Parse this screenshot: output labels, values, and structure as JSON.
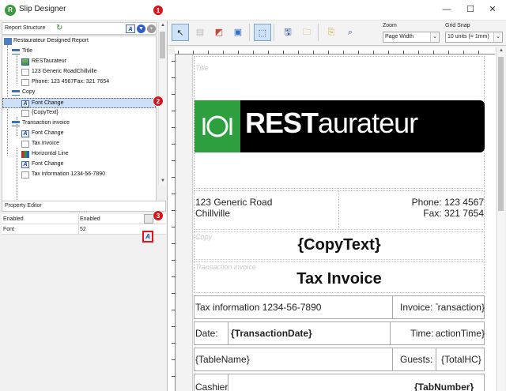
{
  "window": {
    "title": "Slip Designer",
    "minimize": "—",
    "maximize": "☐",
    "close": "✕"
  },
  "callouts": [
    "1",
    "2",
    "3"
  ],
  "report_structure": {
    "label": "Report Structure",
    "tree": [
      {
        "label": "Restaurateur Designed Report",
        "icon": "report-icon",
        "depth": 0
      },
      {
        "label": "Title",
        "icon": "section-icon",
        "depth": 1
      },
      {
        "label": "RESTaurateur",
        "icon": "image-icon",
        "depth": 2
      },
      {
        "label": "123 Generic RoadChillville",
        "icon": "text-icon",
        "depth": 2
      },
      {
        "label": "Phone: 123 4567Fax: 321 7654",
        "icon": "text-icon",
        "depth": 2
      },
      {
        "label": "Copy",
        "icon": "section-icon",
        "depth": 1
      },
      {
        "label": "Font Change",
        "icon": "font-change-icon",
        "depth": 2,
        "selected": true
      },
      {
        "label": "{CopyText}",
        "icon": "text-icon",
        "depth": 2
      },
      {
        "label": "Transaction invoice",
        "icon": "section-icon",
        "depth": 1
      },
      {
        "label": "Font Change",
        "icon": "font-change-icon",
        "depth": 2
      },
      {
        "label": "Tax Invoice",
        "icon": "text-icon",
        "depth": 2
      },
      {
        "label": "Horizontal Line",
        "icon": "horizontal-line-icon",
        "depth": 2
      },
      {
        "label": "Font Change",
        "icon": "font-change-icon",
        "depth": 2
      },
      {
        "label": "Tax information 1234-56-7890",
        "icon": "text-icon",
        "depth": 2
      }
    ]
  },
  "property_editor": {
    "label": "Property Editor",
    "rows": [
      {
        "key": "Enabled",
        "value": "Enabled"
      },
      {
        "key": "Font",
        "value": "52"
      }
    ]
  },
  "toolbar": {
    "zoom_label": "Zoom",
    "zoom_value": "Page Width",
    "grid_label": "Grid Snap",
    "grid_value": "10 units (= 1mm)"
  },
  "slip": {
    "title_section": "Title",
    "logo_bold": "REST",
    "logo_light": "aurateur",
    "address_line1": "123 Generic Road",
    "address_line2": "Chillville",
    "phone": "Phone: 123 4567",
    "fax": "Fax: 321 7654",
    "copy_section": "Copy",
    "copy_text": "{CopyText}",
    "transaction_section": "Transaction invoice",
    "tax_invoice": "Tax Invoice",
    "tax_info": "Tax information 1234-56-7890",
    "invoice_label": "Invoice:",
    "invoice_value": "{Transaction}",
    "date_label": "Date:",
    "date_value": "{TransactionDate}",
    "time_label": "Time:",
    "time_value": "{TransactionTime}",
    "table_name": "{TableName}",
    "guests_label": "Guests:",
    "guests_value": "{TotalHC}",
    "cashier_label": "Cashier",
    "tab_value": "{TabNumber}"
  },
  "colors": {
    "accent_green": "#2e9f3f",
    "callout_red": "#d4161c",
    "selection": "#cbe0f7"
  }
}
